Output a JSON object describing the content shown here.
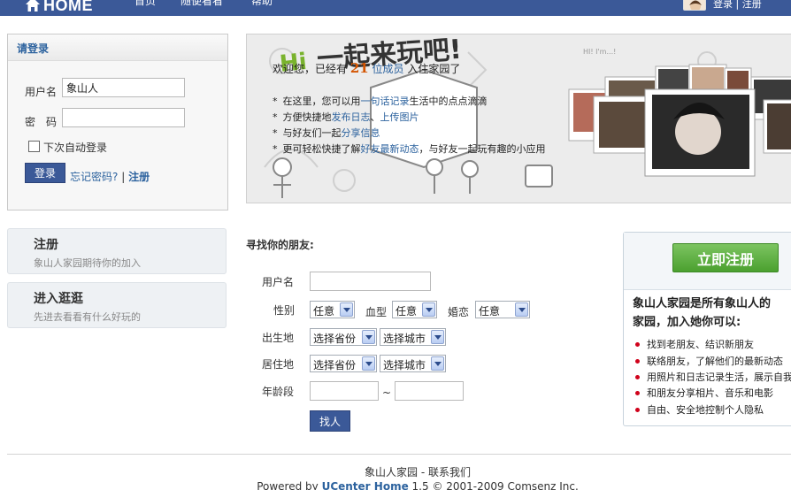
{
  "topbar": {
    "home_label": "HOME",
    "nav": [
      "首页",
      "随便看看",
      "帮助"
    ],
    "login_link": "登录",
    "separator": "|",
    "register_link": "注册"
  },
  "login": {
    "title": "请登录",
    "username_label": "用户名",
    "username_value": "象山人",
    "password_label": "密　码",
    "password_value": "",
    "remember_label": "下次自动登录",
    "submit_label": "登录",
    "forgot_label": "忘记密码?",
    "separator": "|",
    "register_label": "注册"
  },
  "side": [
    {
      "title": "注册",
      "desc": "象山人家园期待你的加入"
    },
    {
      "title": "进入逛逛",
      "desc": "先进去看看有什么好玩的"
    }
  ],
  "banner": {
    "slogan": "Hi 一起来玩吧!",
    "welcome_prefix": "欢迎您，已经有",
    "member_count": "21",
    "member_unit": "位成员",
    "welcome_suffix": "入住家园了",
    "features": [
      {
        "pre": "在这里，您可以用",
        "link": "一句话记录",
        "post": "生活中的点点滴滴",
        "link2": "",
        "post2": ""
      },
      {
        "pre": "方便快捷地",
        "link": "发布日志",
        "post": "、",
        "link2": "上传图片",
        "post2": ""
      },
      {
        "pre": "与好友们一起",
        "link": "分享信息",
        "post": "",
        "link2": "",
        "post2": ""
      },
      {
        "pre": "更可轻松快捷了解",
        "link": "好友最新动态",
        "post": "，与好友一起玩有趣的小应用",
        "link2": "",
        "post2": ""
      }
    ]
  },
  "finder": {
    "title": "寻找你的朋友:",
    "username_label": "用户名",
    "gender_label": "性别",
    "gender_value": "任意",
    "blood_label": "血型",
    "blood_value": "任意",
    "marriage_label": "婚恋",
    "marriage_value": "任意",
    "birthplace_label": "出生地",
    "residence_label": "居住地",
    "province_value": "选择省份",
    "city_value": "选择城市",
    "age_label": "年龄段",
    "age_sep": "~",
    "submit_label": "找人"
  },
  "register_panel": {
    "button_label": "立即注册",
    "heading_line1": "象山人家园是所有象山人的",
    "heading_line2": "家园，加入她你可以:",
    "items": [
      "找到老朋友、结识新朋友",
      "联络朋友，了解他们的最新动态",
      "用照片和日志记录生活，展示自我",
      "和朋友分享相片、音乐和电影",
      "自由、安全地控制个人隐私"
    ]
  },
  "footer": {
    "site_name": "象山人家园",
    "dash": " - ",
    "contact": "联系我们",
    "powered_by": "Powered by",
    "product": "UCenter Home",
    "version_copy": "1.5 © 2001-2009 Comsenz Inc."
  },
  "colors": {
    "topbar": "#3b5998",
    "link": "#2c629e",
    "count": "#d45400",
    "register_green": "#4ba02f",
    "bullet_red": "#d0021b"
  }
}
